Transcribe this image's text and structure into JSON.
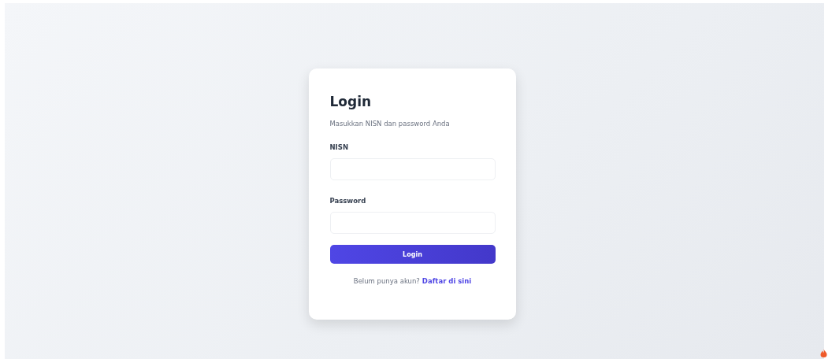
{
  "card": {
    "title": "Login",
    "subtitle": "Masukkan NISN dan password Anda"
  },
  "fields": [
    {
      "label": "NISN"
    },
    {
      "label": "Password"
    }
  ],
  "submit": {
    "label": "Login"
  },
  "footer": {
    "text": "Belum punya akun?",
    "link": "Daftar di sini"
  }
}
